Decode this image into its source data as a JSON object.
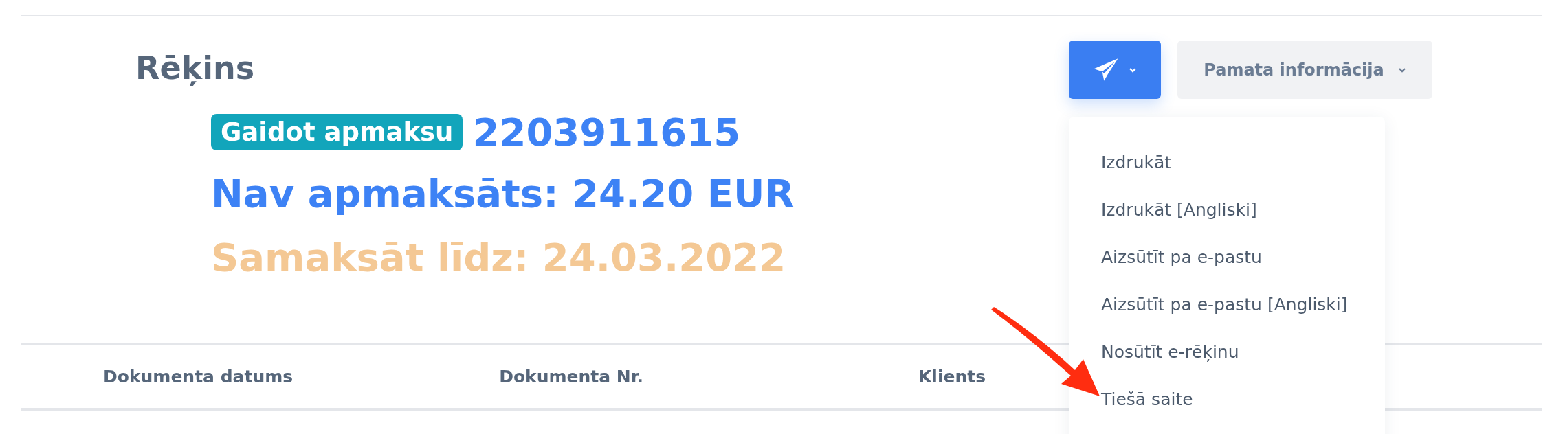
{
  "title": "Rēķins",
  "status_badge": "Gaidot apmaksu",
  "invoice_number": "2203911615",
  "unpaid": "Nav apmaksāts: 24.20 EUR",
  "due": "Samaksāt līdz: 24.03.2022",
  "send_button": {
    "expanded": true
  },
  "info_button": {
    "label": "Pamata informācija"
  },
  "menu": [
    "Izdrukāt",
    "Izdrukāt [Angliski]",
    "Aizsūtīt pa e-pastu",
    "Aizsūtīt pa e-pastu [Angliski]",
    "Nosūtīt e-rēķinu",
    "Tiešā saite"
  ],
  "table": {
    "columns": [
      "Dokumenta datums",
      "Dokumenta Nr.",
      "Klients"
    ]
  }
}
